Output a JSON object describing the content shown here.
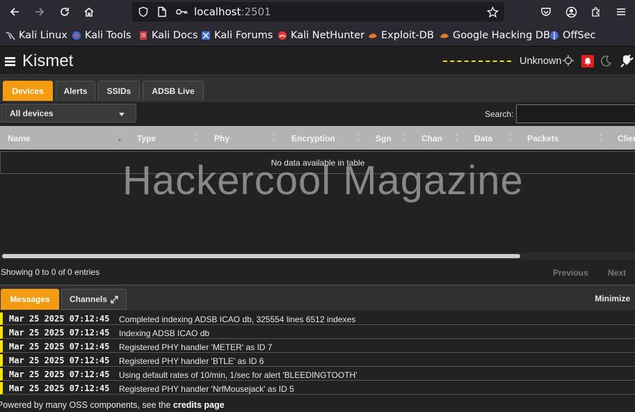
{
  "browser": {
    "url_host": "localhost",
    "url_port": ":2501",
    "bookmarks": [
      {
        "label": "Kali Linux",
        "icon": "kali-dragon-icon"
      },
      {
        "label": "Kali Tools",
        "icon": "kali-tools-icon"
      },
      {
        "label": "Kali Docs",
        "icon": "kali-docs-icon"
      },
      {
        "label": "Kali Forums",
        "icon": "kali-forums-icon"
      },
      {
        "label": "Kali NetHunter",
        "icon": "nethunter-icon"
      },
      {
        "label": "Exploit-DB",
        "icon": "exploit-db-icon"
      },
      {
        "label": "Google Hacking DB",
        "icon": "ghdb-icon"
      },
      {
        "label": "OffSec",
        "icon": "offsec-icon"
      }
    ]
  },
  "app": {
    "title": "Kismet",
    "gps_status": "Unknown"
  },
  "tabs": [
    "Devices",
    "Alerts",
    "SSIDs",
    "ADSB Live"
  ],
  "toolbar": {
    "device_filter": "All devices",
    "search_label": "Search:"
  },
  "table": {
    "columns": [
      "Name",
      "Type",
      "Phy",
      "Encryption",
      "Sgn",
      "Chan",
      "Data",
      "Packets",
      "Clients"
    ],
    "empty_text": "No data available in table",
    "info": "Showing 0 to 0 of 0 entries",
    "previous_label": "Previous",
    "next_label": "Next"
  },
  "watermark": "Hackercool Magazine",
  "messages_panel": {
    "tabs": [
      "Messages",
      "Channels"
    ],
    "minimize_label": "Minimize",
    "messages": [
      {
        "time": "Mar 25 2025 07:12:45",
        "text": "Completed indexing ADSB ICAO db, 325554 lines 6512 indexes"
      },
      {
        "time": "Mar 25 2025 07:12:45",
        "text": "Indexing ADSB ICAO db"
      },
      {
        "time": "Mar 25 2025 07:12:45",
        "text": "Registered PHY handler 'METER' as ID 7"
      },
      {
        "time": "Mar 25 2025 07:12:45",
        "text": "Registered PHY handler 'BTLE' as ID 6"
      },
      {
        "time": "Mar 25 2025 07:12:45",
        "text": "Using default rates of 10/min, 1/sec for alert 'BLEEDINGTOOTH'"
      },
      {
        "time": "Mar 25 2025 07:12:45",
        "text": "Registered PHY handler 'NrfMousejack' as ID 5"
      }
    ]
  },
  "footer": {
    "text": "Powered by many OSS components, see the ",
    "link": "credits page"
  },
  "colors": {
    "accent": "#f39c12",
    "message_marker": "#f5e400",
    "alert": "#e02020"
  }
}
